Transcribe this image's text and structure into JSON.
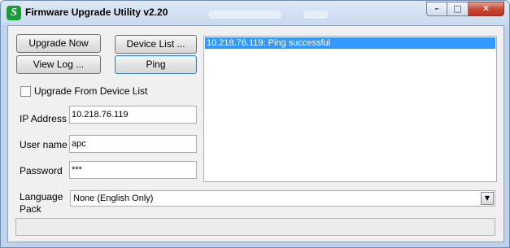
{
  "window": {
    "title": "Firmware Upgrade Utility v2.20",
    "icon": "app-logo-icon",
    "controls": {
      "minimize": "minimize-icon",
      "maximize": "maximize-icon",
      "close": "close-icon"
    }
  },
  "buttons": {
    "upgrade_now": "Upgrade Now",
    "device_list": "Device List ...",
    "view_log": "View Log ...",
    "ping": "Ping"
  },
  "checkbox": {
    "label": "Upgrade From Device List",
    "checked": false
  },
  "fields": {
    "ip": {
      "label": "IP Address",
      "value": "10.218.76.119"
    },
    "user": {
      "label": "User name",
      "value": "apc"
    },
    "password": {
      "label": "Password",
      "value": "***"
    }
  },
  "log": {
    "entries": [
      "10.218.76.119: Ping successful"
    ]
  },
  "language": {
    "label_line1": "Language",
    "label_line2": "Pack",
    "selected": "None (English Only)"
  },
  "status": {
    "text": ""
  },
  "colors": {
    "selection": "#3399ff",
    "close_button": "#c74a36",
    "logo": "#1a9b3a"
  }
}
